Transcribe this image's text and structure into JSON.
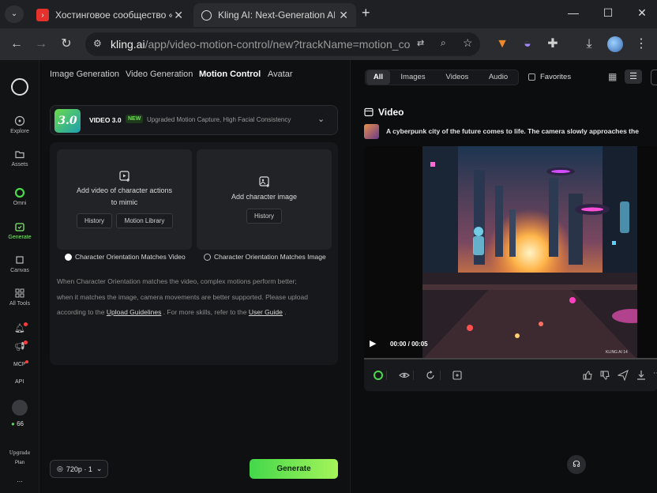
{
  "browser": {
    "tabs": [
      {
        "title": "Хостинговое сообщество «Tim",
        "favicon": "youtube-red-icon",
        "active": false
      },
      {
        "title": "Kling AI: Next-Generation AI Cr",
        "favicon": "kling-logo-icon",
        "active": true
      }
    ],
    "new_tab": "+",
    "url_host": "kling.ai",
    "url_rest": "/app/video-motion-control/new?trackName=motion_control..."
  },
  "rail": {
    "items": [
      {
        "label": "Explore",
        "icon": "explore-icon"
      },
      {
        "label": "Assets",
        "icon": "folder-icon"
      },
      {
        "label": "Omni",
        "icon": "omni-ring-icon"
      },
      {
        "label": "Generate",
        "icon": "generate-icon",
        "active": true
      },
      {
        "label": "Canvas",
        "icon": "canvas-icon"
      },
      {
        "label": "All Tools",
        "icon": "grid-icon"
      }
    ],
    "mcp_label": "MCP",
    "api_label": "API",
    "credits": "66",
    "upgrade_line1": "Upgrade",
    "upgrade_line2": "Plan",
    "more": "..."
  },
  "left": {
    "tabs": [
      "Image Generation",
      "Video Generation",
      "Motion Control",
      "Avatar"
    ],
    "active_tab": "Motion Control",
    "model": {
      "thumb": "3.0",
      "name": "VIDEO 3.0",
      "badge": "NEW",
      "desc": "Upgraded Motion Capture, High Facial Consistency"
    },
    "video_box": {
      "line1": "Add video of character actions",
      "line2": "to mimic",
      "btn_history": "History",
      "btn_library": "Motion Library",
      "orientation": "Character Orientation Matches Video"
    },
    "image_box": {
      "line1": "Add character image",
      "btn_history": "History",
      "orientation": "Character Orientation Matches Image"
    },
    "help_1": "When Character Orientation matches the video, complex motions perform better;",
    "help_2": "when it matches the image, camera movements are better supported. Please upload",
    "help_3a": "according to the ",
    "help_link1": "Upload Guidelines",
    "help_3b": " . For more skills, refer to the ",
    "help_link2": "User Guide",
    "help_3c": " .",
    "resolution": "720p · 1",
    "generate": "Generate"
  },
  "right": {
    "filters": [
      "All",
      "Images",
      "Videos",
      "Audio"
    ],
    "favorites": "Favorites",
    "section_title": "Video",
    "prompt": "A cyberpunk city of the future comes to life. The camera slowly approaches the",
    "time": "00:00 / 00:05",
    "watermark": "KLING AI 14"
  },
  "colors": {
    "accent": "#7ef06b",
    "generate_start": "#43d84a",
    "generate_end": "#a5f45a"
  }
}
